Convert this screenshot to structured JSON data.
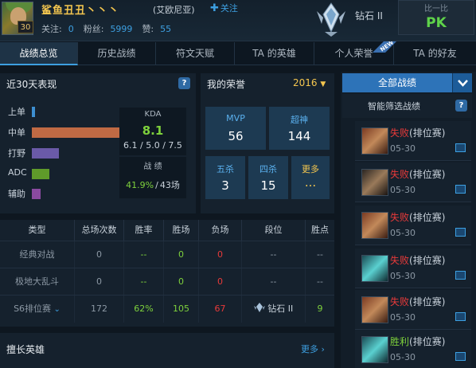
{
  "header": {
    "summoner_name": "鲨鱼丑丑丶丶丶",
    "level": "30",
    "server": "(艾欧尼亚)",
    "follow_label": "关注",
    "following_label": "关注:",
    "following_value": "0",
    "fans_label": "粉丝:",
    "fans_value": "5999",
    "likes_label": "赞:",
    "likes_value": "55",
    "rank": "钻石 II",
    "compare_label": "比一比",
    "compare_pk": "PK"
  },
  "tabs": [
    {
      "label": "战绩总览",
      "active": true
    },
    {
      "label": "历史战绩",
      "active": false
    },
    {
      "label": "符文天赋",
      "active": false
    },
    {
      "label": "TA 的英雄",
      "active": false
    },
    {
      "label": "个人荣誉",
      "active": false,
      "badge": "NEW"
    },
    {
      "label": "TA 的好友",
      "active": false
    }
  ],
  "recent30": {
    "title": "近30天表现",
    "positions": [
      {
        "label": "上单",
        "share": 0.04,
        "color": "#3d8fd1"
      },
      {
        "label": "中单",
        "share": 1.0,
        "color": "#c06a44"
      },
      {
        "label": "打野",
        "share": 0.3,
        "color": "#6a5aa8"
      },
      {
        "label": "ADC",
        "share": 0.2,
        "color": "#5f9a2a"
      },
      {
        "label": "辅助",
        "share": 0.1,
        "color": "#8a4aa0"
      }
    ],
    "kda_label": "KDA",
    "kda_value": "8.1",
    "kda_detail": "6.1 / 5.0 / 7.5",
    "record_label": "战 绩",
    "record_winrate": "41.9%",
    "record_sep": "/",
    "record_games": "43场"
  },
  "honor": {
    "title": "我的荣誉",
    "year": "2016",
    "mvp_label": "MVP",
    "mvp_value": "56",
    "legendary_label": "超神",
    "legendary_value": "144",
    "penta_label": "五杀",
    "penta_value": "3",
    "quadra_label": "四杀",
    "quadra_value": "15",
    "more_label": "更多",
    "more_value": "..."
  },
  "table": {
    "headers": [
      "类型",
      "总场次数",
      "胜率",
      "胜场",
      "负场",
      "段位",
      "胜点"
    ],
    "rows": [
      {
        "type": "经典对战",
        "total": "0",
        "winrate": "--",
        "wins": "0",
        "losses": "0",
        "tier": "--",
        "lp": "--"
      },
      {
        "type": "极地大乱斗",
        "total": "0",
        "winrate": "--",
        "wins": "0",
        "losses": "0",
        "tier": "--",
        "lp": "--"
      },
      {
        "type": "S6排位赛",
        "total": "172",
        "winrate": "62%",
        "wins": "105",
        "losses": "67",
        "tier": "钻石 II",
        "lp": "9"
      }
    ]
  },
  "champions": {
    "title": "擅长英雄",
    "more": "更多"
  },
  "matches_panel": {
    "all_label": "全部战绩",
    "filter_label": "智能筛选战绩",
    "matches": [
      {
        "result": "失败",
        "mode": "(排位赛)",
        "date": "05-30",
        "win": false
      },
      {
        "result": "失败",
        "mode": "(排位赛)",
        "date": "05-30",
        "win": false
      },
      {
        "result": "失败",
        "mode": "(排位赛)",
        "date": "05-30",
        "win": false
      },
      {
        "result": "失败",
        "mode": "(排位赛)",
        "date": "05-30",
        "win": false
      },
      {
        "result": "失败",
        "mode": "(排位赛)",
        "date": "05-30",
        "win": false
      },
      {
        "result": "胜利",
        "mode": "(排位赛)",
        "date": "05-30",
        "win": true
      }
    ]
  },
  "colors": {
    "accent": "#3d9fe0",
    "win": "#7ed13c",
    "loss": "#e83a3a",
    "gold": "#f4c64f"
  }
}
